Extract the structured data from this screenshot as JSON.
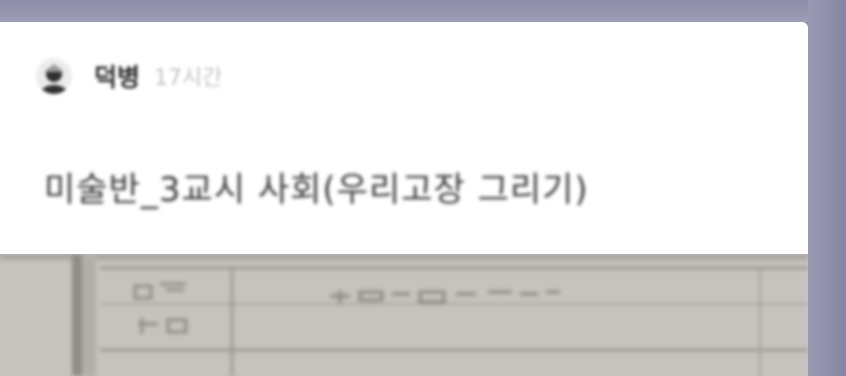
{
  "post": {
    "author": "덕병",
    "time": "17시간",
    "title": "미술반_3교시 사회(우리고장 그리기)",
    "avatar_icon": "person-avatar-icon"
  },
  "photo": {
    "subject": "handwritten worksheet photo",
    "visible_text": [
      "고장",
      "지 도",
      "(자리 표시 자)"
    ]
  },
  "colors": {
    "background": "#8f8fab",
    "card": "#ffffff",
    "title_text": "#3a3a3a",
    "time_text": "#c2c2c2"
  }
}
